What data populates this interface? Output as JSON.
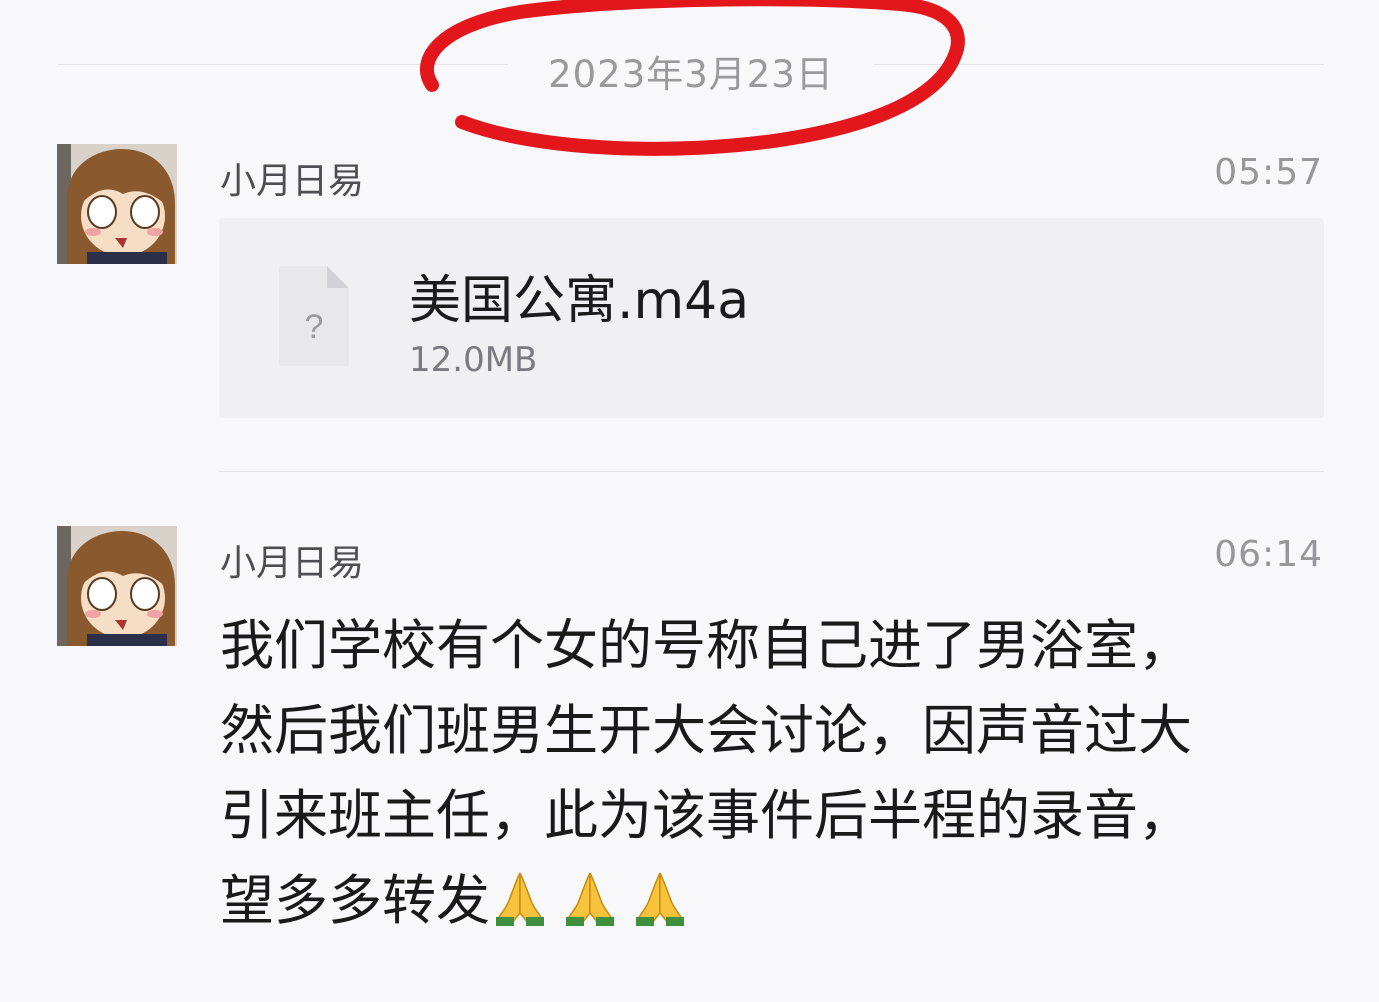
{
  "chat": {
    "date": "2023年3月23日",
    "messages": [
      {
        "sender": "小月日易",
        "time": "05:57",
        "file": {
          "name": "美国公寓.m4a",
          "size": "12.0MB",
          "icon_glyph": "?"
        }
      },
      {
        "sender": "小月日易",
        "time": "06:14",
        "text_lines": [
          "我们学校有个女的号称自己进了男浴室，",
          "然后我们班男生开大会讨论，因声音过大",
          "引来班主任，此为该事件后半程的录音，",
          "望多多转发"
        ],
        "emoji": [
          "🙏",
          "🙏",
          "🙏"
        ]
      }
    ]
  },
  "colors": {
    "annotation_red": "#e3161c",
    "background": "#f8f8fa",
    "card": "#f0f0f2"
  }
}
